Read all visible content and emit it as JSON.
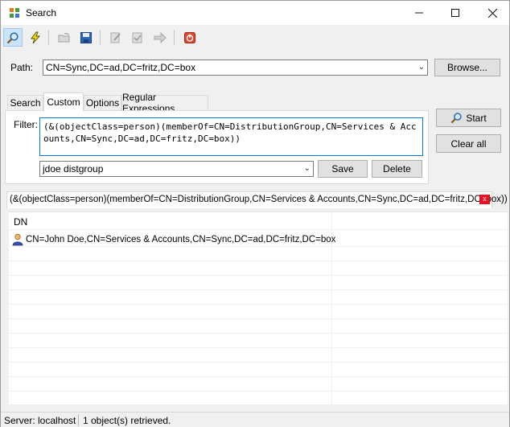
{
  "window": {
    "title": "Search"
  },
  "toolbar": {
    "items": [
      "search-icon",
      "lightning-icon",
      "open-icon",
      "save-icon",
      "edit-icon",
      "check-icon",
      "arrow-icon",
      "stop-icon"
    ]
  },
  "path": {
    "label": "Path:",
    "value": "CN=Sync,DC=ad,DC=fritz,DC=box",
    "browse_label": "Browse..."
  },
  "tabs": [
    {
      "label": "Search"
    },
    {
      "label": "Custom"
    },
    {
      "label": "Options"
    },
    {
      "label": "Regular Expressions"
    }
  ],
  "filter": {
    "label": "Filter:",
    "value": "(&(objectClass=person)(memberOf=CN=DistributionGroup,CN=Services & Accounts,CN=Sync,DC=ad,DC=fritz,DC=box))",
    "saved_name": "jdoe distgroup",
    "save_label": "Save",
    "delete_label": "Delete"
  },
  "actions": {
    "start_label": "Start",
    "clear_label": "Clear all"
  },
  "result_tab": {
    "label": "(&(objectClass=person)(memberOf=CN=DistributionGroup,CN=Services & Accounts,CN=Sync,DC=ad,DC=fritz,DC=box))",
    "close_glyph": "x"
  },
  "results": {
    "columns": [
      "DN"
    ],
    "rows": [
      "CN=John Doe,CN=Services & Accounts,CN=Sync,DC=ad,DC=fritz,DC=box"
    ]
  },
  "status": {
    "server": "Server: localhost",
    "summary": "1 object(s) retrieved."
  },
  "colors": {
    "accent": "#0078d7",
    "close_red": "#e81123"
  }
}
